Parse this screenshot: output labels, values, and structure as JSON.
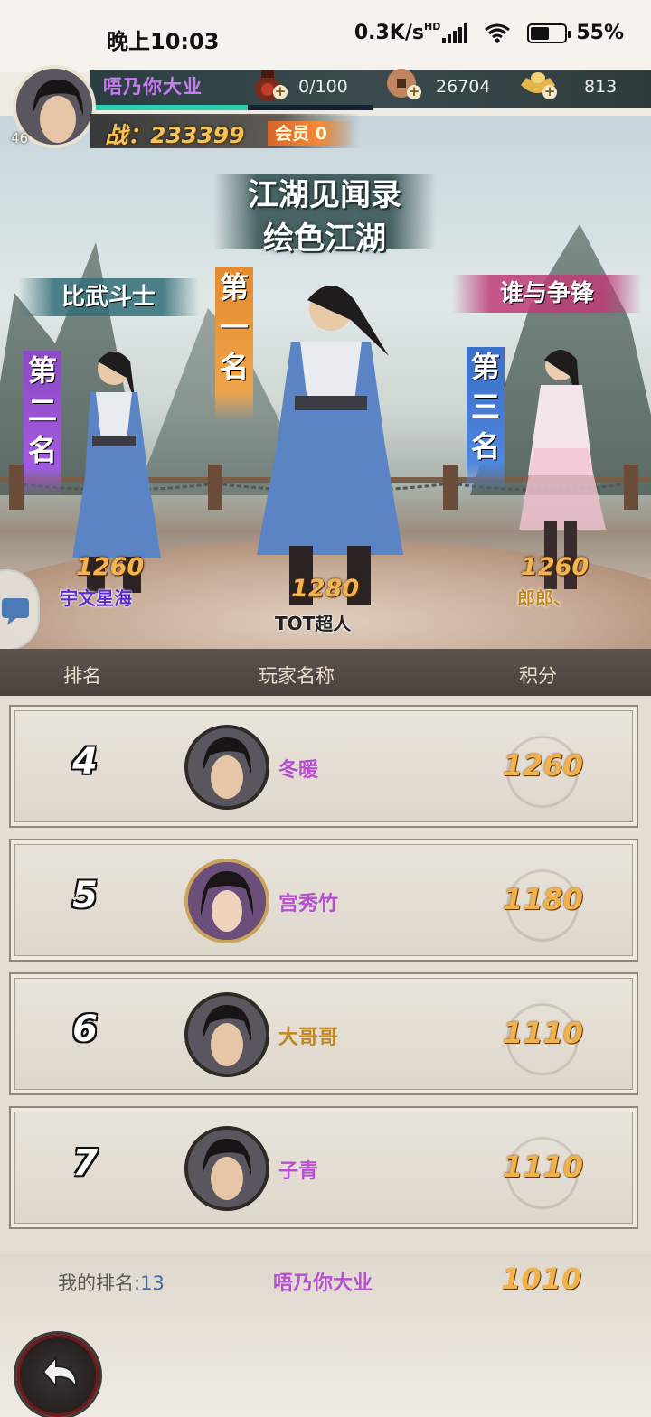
{
  "status_bar": {
    "time": "晚上10:03",
    "network_speed": "0.3K/s",
    "network_badge": "HD",
    "battery": "55%",
    "battery_level": 0.55
  },
  "hud": {
    "player_name": "唔乃你大业",
    "level": "46",
    "power": "战：233399",
    "vip": "会员 0",
    "progress_level": 0.55,
    "resources": [
      {
        "icon": "stamina-jar-icon",
        "value": "0/100"
      },
      {
        "icon": "copper-coin-icon",
        "value": "26704"
      },
      {
        "icon": "gold-ingot-icon",
        "value": "813"
      }
    ]
  },
  "scene": {
    "title_line1": "江湖见闻录",
    "title_line2": "绘色江湖",
    "left_tag": "比武斗士",
    "right_tag": "谁与争锋",
    "podium": [
      {
        "rank_label": "第一名",
        "score": "1280",
        "name": "TOT超人",
        "name_color": "#222222"
      },
      {
        "rank_label": "第二名",
        "score": "1260",
        "name": "宇文星海",
        "name_color": "#5b2bd0"
      },
      {
        "rank_label": "第三名",
        "score": "1260",
        "name": "郎郎、",
        "name_color": "#c2871e"
      }
    ]
  },
  "ranking": {
    "headers": {
      "rank": "排名",
      "name": "玩家名称",
      "score": "积分"
    },
    "rows": [
      {
        "rank": "4",
        "name": "冬暖",
        "score": "1260",
        "name_color": "#b64fd2"
      },
      {
        "rank": "5",
        "name": "宫秀竹",
        "score": "1180",
        "name_color": "#b64fd2"
      },
      {
        "rank": "6",
        "name": "大哥哥",
        "score": "1110",
        "name_color": "#c2871e"
      },
      {
        "rank": "7",
        "name": "子青",
        "score": "1110",
        "name_color": "#b64fd2"
      }
    ],
    "mine": {
      "label": "我的排名:",
      "rank": "13",
      "name": "唔乃你大业",
      "score": "1010"
    }
  },
  "colors": {
    "gold_score": "#f1b24d",
    "purple_name": "#b64fd2",
    "header_bg": "#4f4842"
  }
}
